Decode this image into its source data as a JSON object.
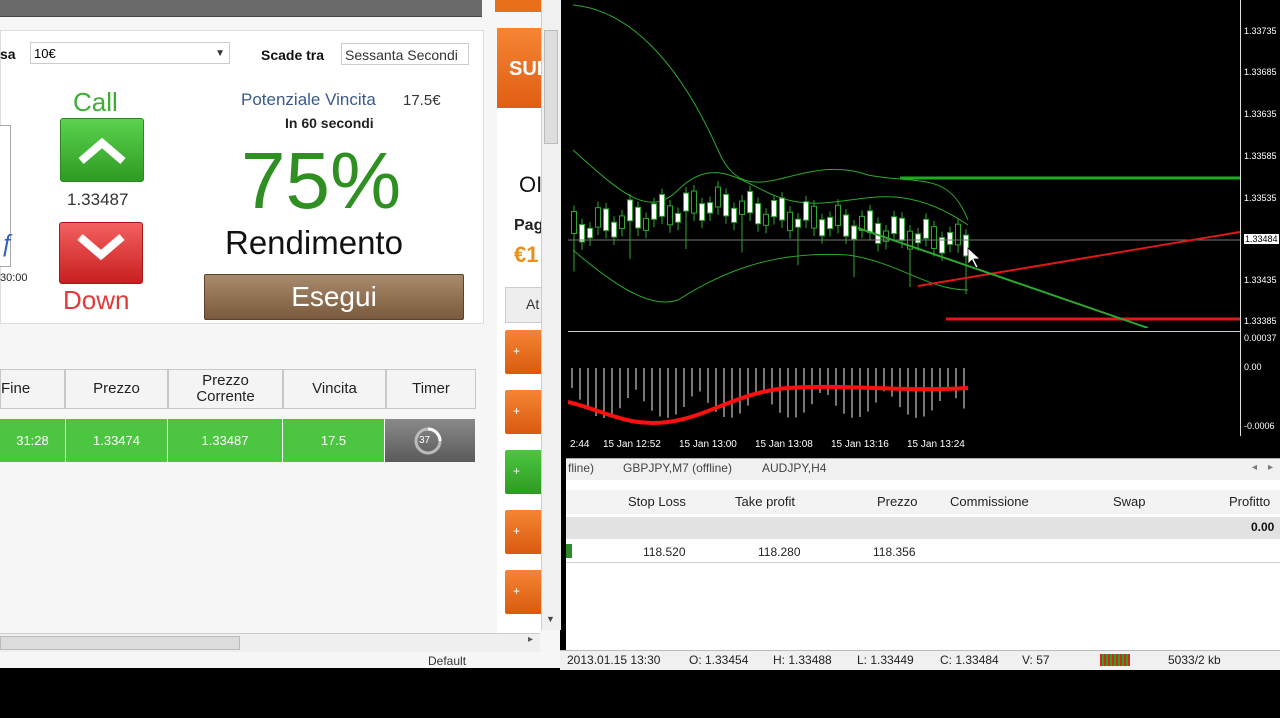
{
  "left_panel": {
    "amount_label_fragment": "sa",
    "amount_value": "10€",
    "expiry_label": "Scade tra",
    "expiry_value": "Sessanta Secondi",
    "call_label": "Call",
    "call_price": "1.33487",
    "down_label": "Down",
    "thumb_time": "30:00",
    "potential_label": "Potenziale Vincita",
    "potential_value": "17.5€",
    "in_seconds": "In 60 secondi",
    "percent": "75%",
    "rendimento": "Rendimento",
    "esegui": "Esegui",
    "table": {
      "headers": [
        "Fine",
        "Prezzo",
        "Prezzo\nCorrente",
        "Vincita",
        "Timer"
      ],
      "row": [
        "31:28",
        "1.33474",
        "1.33487",
        "17.5",
        "37"
      ]
    }
  },
  "side_column": {
    "top_text": "SUP",
    "o_text": "OI",
    "pag_text": "Pag",
    "euro_text": "€1",
    "at_text": "At"
  },
  "chart": {
    "price_labels": [
      "1.33735",
      "1.33685",
      "1.33635",
      "1.33585",
      "1.33535",
      "1.33484",
      "1.33435",
      "1.33385"
    ],
    "osc_labels": [
      "0.00037",
      "0.00",
      "-0.0006"
    ],
    "time_labels": [
      "2:44",
      "15 Jan 12:52",
      "15 Jan 13:00",
      "15 Jan 13:08",
      "15 Jan 13:16",
      "15 Jan 13:24"
    ]
  },
  "tabs": [
    "fline)",
    "GBPJPY,M7 (offline)",
    "AUDJPY,H4"
  ],
  "terminal": {
    "headers": [
      "Stop Loss",
      "Take profit",
      "Prezzo",
      "Commissione",
      "Swap",
      "Profitto"
    ],
    "total": "0.00",
    "row": [
      "118.520",
      "118.280",
      "118.356"
    ]
  },
  "status": {
    "default_label": "Default",
    "datetime": "2013.01.15 13:30",
    "open": "O: 1.33454",
    "high": "H: 1.33488",
    "low": "L: 1.33449",
    "close": "C: 1.33484",
    "volume": "V: 57",
    "traffic": "5033/2 kb"
  },
  "colors": {
    "call_green": "#3eae32",
    "down_red": "#e03a3a",
    "percent_green": "#2f8f22",
    "row_green": "#4cc640",
    "esegui_brown": "#8b6b4c",
    "accent_orange": "#e8701a"
  }
}
